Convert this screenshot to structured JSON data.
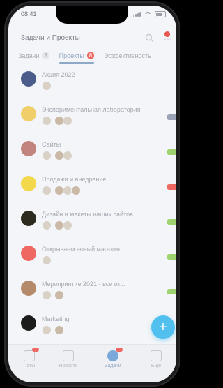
{
  "status_bar": {
    "time": "08:41"
  },
  "header": {
    "title": "Задачи и Проекты"
  },
  "tabs": [
    {
      "label": "Задачи",
      "count": "3"
    },
    {
      "label": "Проекты",
      "count": "8"
    },
    {
      "label": "Эффективность",
      "count": ""
    }
  ],
  "projects": [
    {
      "title": "Акция 2022",
      "avatar_color": "#4a5d8a",
      "members": 1,
      "pill_color": ""
    },
    {
      "title": "Экспериментальная лаборатория",
      "avatar_color": "#f0cf6a",
      "members": 3,
      "pill_color": "#9aa3b5"
    },
    {
      "title": "Сайты",
      "avatar_color": "#c2857e",
      "members": 3,
      "pill_color": "#9fd36f"
    },
    {
      "title": "Продажи и внедрение",
      "avatar_color": "#f2d84a",
      "members": 4,
      "pill_color": "#ee6961"
    },
    {
      "title": "Дизайн и макеты наших сайтов",
      "avatar_color": "#2d2b1e",
      "members": 3,
      "pill_color": "#9fd36f"
    },
    {
      "title": "Открываем новый магазин",
      "avatar_color": "#ee6961",
      "members": 1,
      "pill_color": "#9fd36f"
    },
    {
      "title": "Мероприятие 2021 - все ит...",
      "avatar_color": "#b58a6b",
      "members": 2,
      "pill_color": "#9fd36f"
    },
    {
      "title": "Marketing",
      "avatar_color": "#1c1c1c",
      "members": 2,
      "pill_color": ""
    }
  ],
  "bottom_nav": [
    {
      "label": "Чаты",
      "badge": true,
      "active": false
    },
    {
      "label": "Новости",
      "badge": false,
      "active": false
    },
    {
      "label": "Задачи",
      "badge": true,
      "active": true
    },
    {
      "label": "Ещё",
      "badge": false,
      "active": false
    }
  ],
  "fab": {
    "icon": "plus-icon",
    "label": "+"
  }
}
